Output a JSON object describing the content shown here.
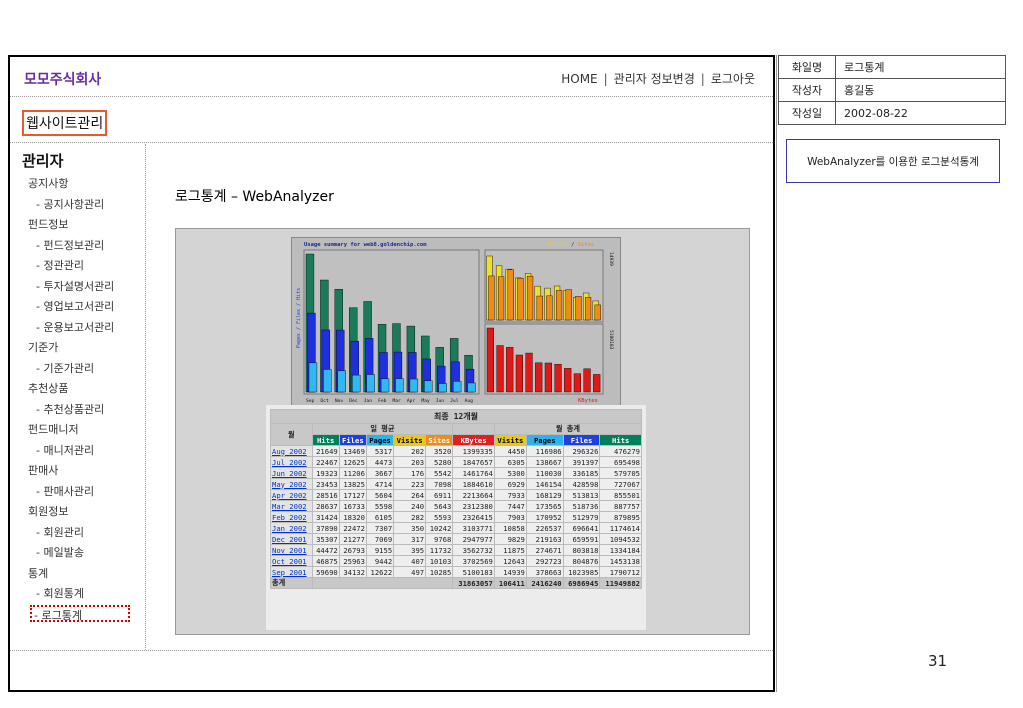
{
  "header": {
    "company": "모모주식회사",
    "nav": [
      "HOME",
      "관리자 정보변경",
      "로그아웃"
    ]
  },
  "site_title": "웹사이트관리",
  "menu_title": "관리자",
  "menu": [
    {
      "label": "공지사항",
      "level": 1
    },
    {
      "label": "- 공지사항관리",
      "level": 2
    },
    {
      "label": "펀드정보",
      "level": 1
    },
    {
      "label": "- 펀드정보관리",
      "level": 2
    },
    {
      "label": "- 정관관리",
      "level": 2
    },
    {
      "label": "- 투자설명서관리",
      "level": 2
    },
    {
      "label": "- 영업보고서관리",
      "level": 2
    },
    {
      "label": "- 운용보고서관리",
      "level": 2
    },
    {
      "label": "기준가",
      "level": 1
    },
    {
      "label": "- 기준가관리",
      "level": 2
    },
    {
      "label": "추천상품",
      "level": 1
    },
    {
      "label": "- 추천상품관리",
      "level": 2
    },
    {
      "label": "펀드매니저",
      "level": 1
    },
    {
      "label": "- 매니저관리",
      "level": 2
    },
    {
      "label": "판매사",
      "level": 1
    },
    {
      "label": "- 판매사관리",
      "level": 2
    },
    {
      "label": "회원정보",
      "level": 1
    },
    {
      "label": "- 회원관리",
      "level": 2
    },
    {
      "label": "- 메일발송",
      "level": 2
    },
    {
      "label": "통계",
      "level": 1
    },
    {
      "label": "- 회원통계",
      "level": 2
    },
    {
      "label": "- 로그통계",
      "level": 2,
      "selected": true
    }
  ],
  "content_heading": "로그통계 – WebAnalyzer",
  "meta": [
    {
      "key": "화일명",
      "value": "로그통계"
    },
    {
      "key": "작성자",
      "value": "홍길동"
    },
    {
      "key": "작성일",
      "value": "2002-08-22"
    }
  ],
  "description": "WebAnalyzer를 이용한 로그분석통계",
  "page_number": "31",
  "chart_data": {
    "type": "bar",
    "title": "Usage summary for web8.goldenchip.com",
    "legend_right": [
      "Visits",
      "Sites"
    ],
    "left_axis_label": "Pages / Files / Hits",
    "left_axis_max_label": "1790712",
    "right_top_max_label": "14939",
    "right_bottom_max_label": "5100183",
    "bottom_right_label": "KBytes",
    "categories": [
      "Sep",
      "Oct",
      "Nov",
      "Dec",
      "Jan",
      "Feb",
      "Mar",
      "Apr",
      "May",
      "Jun",
      "Jul",
      "Aug"
    ],
    "series": [
      {
        "name": "Hits",
        "values": [
          1790712,
          1453138,
          1334184,
          1094532,
          1174614,
          879895,
          887757,
          855501,
          727067,
          579705,
          695498,
          476279
        ]
      },
      {
        "name": "Files",
        "values": [
          1023985,
          804876,
          803818,
          659591,
          696641,
          512979,
          518736,
          513813,
          428598,
          336185,
          391397,
          296326
        ]
      },
      {
        "name": "Pages",
        "values": [
          378663,
          292723,
          274671,
          219163,
          226537,
          170952,
          173565,
          168129,
          146154,
          110030,
          138667,
          116986
        ]
      },
      {
        "name": "Visits",
        "values": [
          14939,
          12643,
          11875,
          9829,
          10858,
          7903,
          7447,
          7933,
          6929,
          5300,
          6305,
          4450
        ]
      },
      {
        "name": "Sites",
        "values": [
          10285,
          10103,
          11732,
          9768,
          10242,
          5593,
          5643,
          6911,
          7098,
          5542,
          5280,
          3520
        ]
      },
      {
        "name": "KBytes",
        "values": [
          5100183,
          3702569,
          3562732,
          2947977,
          3103771,
          2326415,
          2312380,
          2213664,
          1884610,
          1461764,
          1847657,
          1399335
        ]
      }
    ]
  },
  "table": {
    "caption": "최종 12개월",
    "month_header": "월",
    "daily_avg_header": "일 평균",
    "monthly_total_header": "월 총계",
    "columns": [
      "Hits",
      "Files",
      "Pages",
      "Visits",
      "Sites",
      "KBytes",
      "Visits",
      "Pages",
      "Files",
      "Hits"
    ],
    "column_colors": [
      "#00805a",
      "#1f3fe0",
      "#2ab3ef",
      "#e8c820",
      "#f08a18",
      "#e02020",
      "#e8c820",
      "#2ab3ef",
      "#1f3fe0",
      "#00805a"
    ],
    "rows": [
      [
        "Aug 2002",
        "21649",
        "13469",
        "5317",
        "202",
        "3520",
        "1399335",
        "4450",
        "116986",
        "296326",
        "476279"
      ],
      [
        "Jul 2002",
        "22467",
        "12625",
        "4473",
        "203",
        "5280",
        "1847657",
        "6305",
        "138667",
        "391397",
        "695498"
      ],
      [
        "Jun 2002",
        "19323",
        "11206",
        "3667",
        "176",
        "5542",
        "1461764",
        "5300",
        "110030",
        "336185",
        "579705"
      ],
      [
        "May 2002",
        "23453",
        "13825",
        "4714",
        "223",
        "7098",
        "1884610",
        "6929",
        "146154",
        "428598",
        "727067"
      ],
      [
        "Apr 2002",
        "28516",
        "17127",
        "5604",
        "264",
        "6911",
        "2213664",
        "7933",
        "168129",
        "513813",
        "855501"
      ],
      [
        "Mar 2002",
        "28637",
        "16733",
        "5598",
        "240",
        "5643",
        "2312380",
        "7447",
        "173565",
        "518736",
        "887757"
      ],
      [
        "Feb 2002",
        "31424",
        "18320",
        "6105",
        "282",
        "5593",
        "2326415",
        "7903",
        "170952",
        "512979",
        "879895"
      ],
      [
        "Jan 2002",
        "37890",
        "22472",
        "7307",
        "350",
        "10242",
        "3103771",
        "10858",
        "226537",
        "696641",
        "1174614"
      ],
      [
        "Dec 2001",
        "35307",
        "21277",
        "7069",
        "317",
        "9768",
        "2947977",
        "9829",
        "219163",
        "659591",
        "1094532"
      ],
      [
        "Nov 2001",
        "44472",
        "26793",
        "9155",
        "395",
        "11732",
        "3562732",
        "11875",
        "274671",
        "803818",
        "1334184"
      ],
      [
        "Oct 2001",
        "46875",
        "25963",
        "9442",
        "407",
        "10103",
        "3702569",
        "12643",
        "292723",
        "804876",
        "1453138"
      ],
      [
        "Sep 2001",
        "59690",
        "34132",
        "12622",
        "497",
        "10285",
        "5100183",
        "14939",
        "378663",
        "1023985",
        "1790712"
      ]
    ],
    "total_label": "총계",
    "totals": [
      "31863057",
      "106411",
      "2416240",
      "6986945",
      "11949882"
    ]
  }
}
